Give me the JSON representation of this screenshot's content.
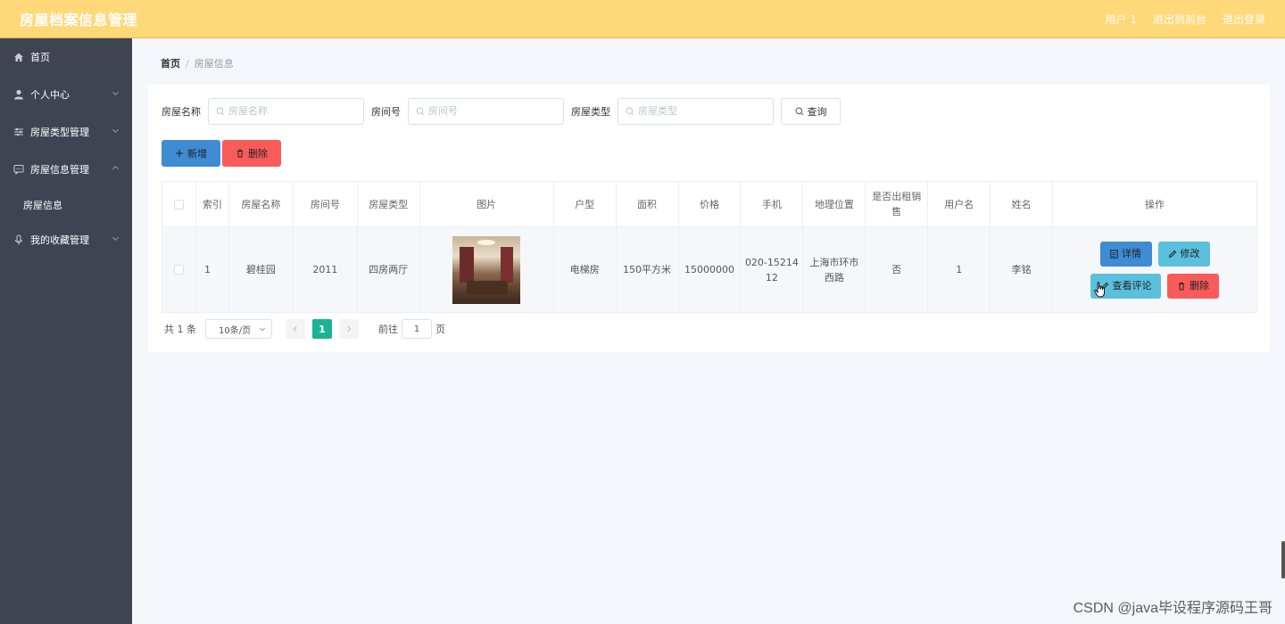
{
  "app": {
    "title": "房屋档案信息管理"
  },
  "topbar": {
    "user": "用户 1",
    "to_front": "退出到前台",
    "logout": "退出登录"
  },
  "sidebar": {
    "items": [
      {
        "label": "首页",
        "icon": "home-icon"
      },
      {
        "label": "个人中心",
        "icon": "user-icon"
      },
      {
        "label": "房屋类型管理",
        "icon": "sliders-icon"
      },
      {
        "label": "房屋信息管理",
        "icon": "chat-icon"
      },
      {
        "label": "房屋信息",
        "icon": ""
      },
      {
        "label": "我的收藏管理",
        "icon": "mic-icon"
      }
    ]
  },
  "breadcrumb": {
    "home": "首页",
    "sep": "/",
    "current": "房屋信息"
  },
  "search": {
    "name_label": "房屋名称",
    "name_placeholder": "房屋名称",
    "room_label": "房间号",
    "room_placeholder": "房间号",
    "type_label": "房屋类型",
    "type_placeholder": "房屋类型",
    "query_label": "查询"
  },
  "actions": {
    "add_label": "新增",
    "delete_label": "删除"
  },
  "table": {
    "headers": [
      "索引",
      "房屋名称",
      "房间号",
      "房屋类型",
      "图片",
      "户型",
      "面积",
      "价格",
      "手机",
      "地理位置",
      "是否出租销售",
      "用户名",
      "姓名",
      "操作"
    ],
    "rows": [
      {
        "index": "1",
        "name": "碧桂园",
        "room": "2011",
        "type": "四房两厅",
        "layout": "电梯房",
        "area": "150平方米",
        "price": "15000000",
        "phone": "020-1521412",
        "location": "上海市环市西路",
        "rented": "否",
        "username": "1",
        "realname": "李铭"
      }
    ],
    "ops": {
      "detail": "详情",
      "edit": "修改",
      "comment": "查看评论",
      "delete": "删除"
    }
  },
  "pager": {
    "total": "共 1 条",
    "page_size": "10条/页",
    "current_page": "1",
    "goto_label": "前往",
    "goto_value": "1",
    "page_unit": "页"
  },
  "watermark": "CSDN @java毕设程序源码王哥",
  "colors": {
    "topbar": "#ffd87a",
    "sidebar": "#3f4453",
    "primary": "#3f8bd4",
    "info": "#5bc0de",
    "danger": "#f95b5b",
    "pager_active": "#1ab394"
  }
}
